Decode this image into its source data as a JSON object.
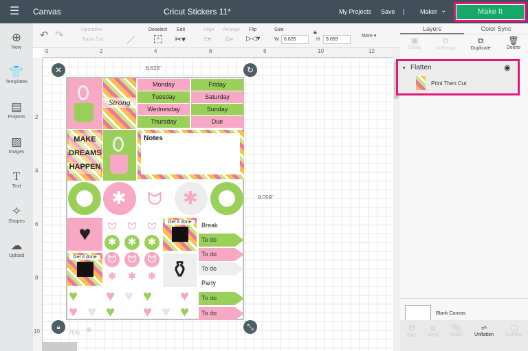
{
  "topbar": {
    "section": "Canvas",
    "title": "Cricut Stickers 11*",
    "my_projects": "My Projects",
    "save": "Save",
    "separator": "|",
    "machine": "Maker",
    "make_it": "Make It",
    "accent": "#16a86a",
    "highlight": "#e0187f"
  },
  "sidebar": {
    "items": [
      {
        "label": "New",
        "icon": "plus-circle-icon"
      },
      {
        "label": "Templates",
        "icon": "shirt-icon"
      },
      {
        "label": "Projects",
        "icon": "notebook-icon"
      },
      {
        "label": "Images",
        "icon": "image-icon"
      },
      {
        "label": "Text",
        "icon": "text-icon"
      },
      {
        "label": "Shapes",
        "icon": "shapes-icon"
      },
      {
        "label": "Upload",
        "icon": "cloud-upload-icon"
      }
    ]
  },
  "toolbar": {
    "operation_label": "Operation",
    "operation_value": "Basic Cut",
    "deselect": "Deselect",
    "edit": "Edit",
    "align": "Align",
    "arrange": "Arrange",
    "flip": "Flip",
    "size": "Size",
    "w_label": "W",
    "w_value": "6.626",
    "h_label": "H",
    "h_value": "9.059",
    "more": "More ▾"
  },
  "ruler": {
    "top": [
      "0",
      "2",
      "4",
      "6",
      "8",
      "10",
      "12"
    ],
    "left": [
      "2",
      "4",
      "6",
      "8",
      "10"
    ]
  },
  "canvas": {
    "width_label": "6.626\"",
    "height_label": "9.059\"",
    "zoom": "75%"
  },
  "sheet": {
    "days": [
      "Monday",
      "Friday",
      "Tuesday",
      "Saturday",
      "Wednesday",
      "Sunday",
      "Thursday",
      "Due"
    ],
    "notes": "Notes",
    "make_dreams": "MAKE DREAMS HAPPEN",
    "strong": "Strong",
    "get_it_done": "Get it done",
    "todo": [
      "Break",
      "To do",
      "To do",
      "To do",
      "Party",
      "To do",
      "To do"
    ]
  },
  "right": {
    "tabs": [
      "Layers",
      "Color Sync"
    ],
    "actions": [
      "Group",
      "UnGroup",
      "Duplicate",
      "Delete"
    ],
    "layer_group": "Flatten",
    "layer_item": "Print Then Cut",
    "blank_canvas": "Blank Canvas",
    "bottom_actions": [
      "Slice",
      "Weld",
      "Attach",
      "Unflatten",
      "Contour"
    ]
  }
}
